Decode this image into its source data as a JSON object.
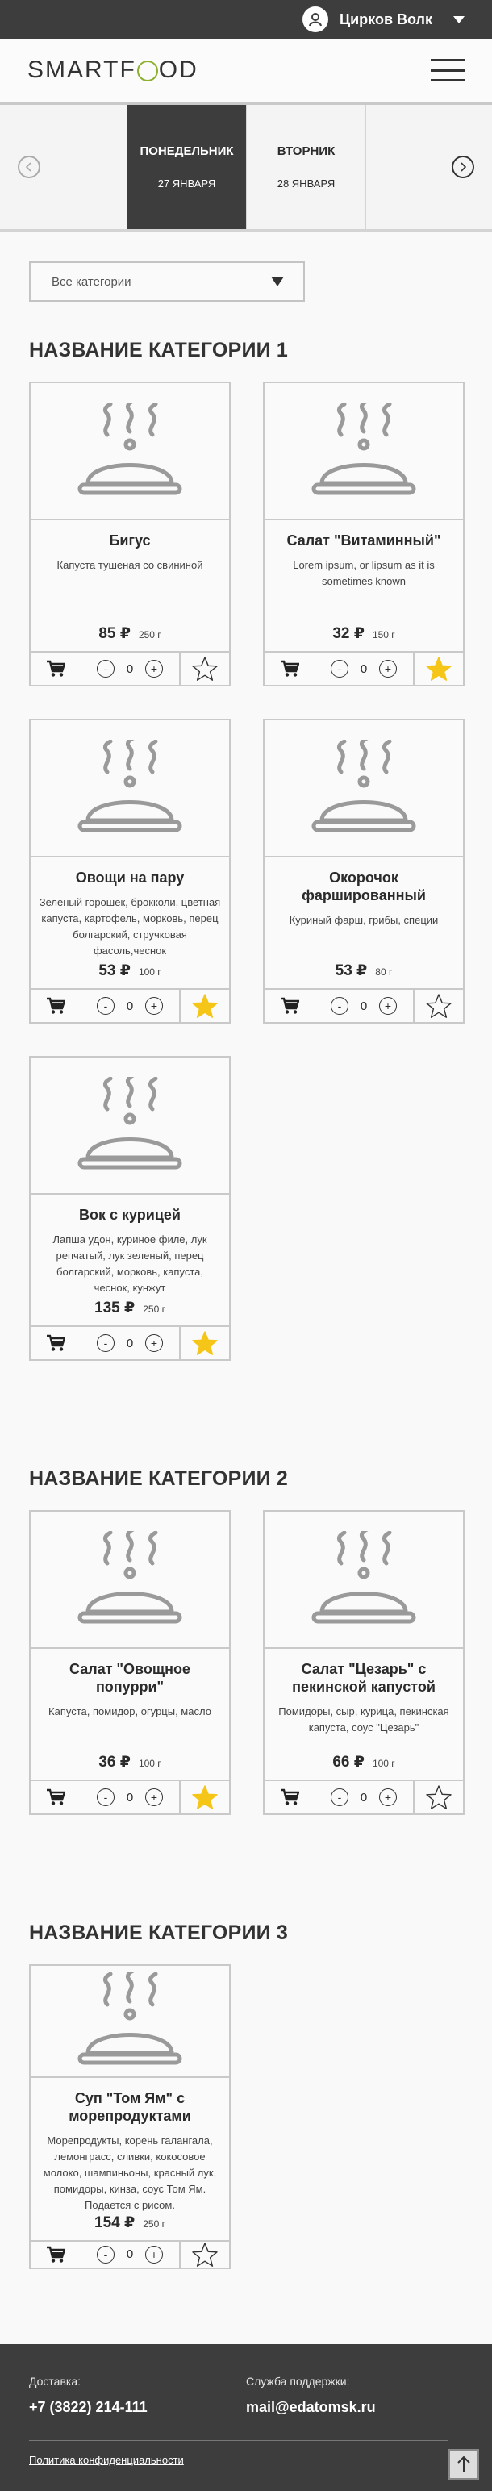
{
  "user": {
    "name": "Цирков Волк"
  },
  "logo": {
    "left": "SMARTF",
    "right": "OD"
  },
  "days": [
    {
      "name": "ПОНЕДЕЛЬНИК",
      "date": "27 ЯНВАРЯ",
      "active": true
    },
    {
      "name": "ВТОРНИК",
      "date": "28 ЯНВАРЯ",
      "active": false
    }
  ],
  "filter": {
    "value": "Все категории"
  },
  "categories": [
    {
      "title": "НАЗВАНИЕ КАТЕГОРИИ 1",
      "items": [
        {
          "title": "Бигус",
          "desc": "Капуста тушеная со свининой",
          "price": "85 ₽",
          "weight": "250 г",
          "qty": "0",
          "fav": false
        },
        {
          "title": "Салат \"Витаминный\"",
          "desc": "Lorem ipsum, or lipsum as it is sometimes known",
          "price": "32 ₽",
          "weight": "150 г",
          "qty": "0",
          "fav": true
        },
        {
          "title": "Овощи на пару",
          "desc": "Зеленый горошек, брокколи, цветная капуста, картофель, морковь, перец болгарский, стручковая фасоль,чеснок",
          "price": "53 ₽",
          "weight": "100 г",
          "qty": "0",
          "fav": true
        },
        {
          "title": "Окорочок фаршированный",
          "desc": "Куриный фарш, грибы, специи",
          "price": "53 ₽",
          "weight": "80 г",
          "qty": "0",
          "fav": false
        },
        {
          "title": "Вок с курицей",
          "desc": "Лапша удон, куриное филе, лук репчатый, лук зеленый, перец болгарский, морковь, капуста, чеснок, кунжут",
          "price": "135 ₽",
          "weight": "250 г",
          "qty": "0",
          "fav": true
        }
      ]
    },
    {
      "title": "НАЗВАНИЕ КАТЕГОРИИ 2",
      "items": [
        {
          "title": "Салат \"Овощное попурри\"",
          "desc": "Капуста, помидор, огурцы, масло",
          "price": "36 ₽",
          "weight": "100 г",
          "qty": "0",
          "fav": true
        },
        {
          "title": "Салат \"Цезарь\" с пекинской капустой",
          "desc": "Помидоры, сыр, курица, пекинская капуста, соус \"Цезарь\"",
          "price": "66 ₽",
          "weight": "100 г",
          "qty": "0",
          "fav": false
        }
      ]
    },
    {
      "title": "НАЗВАНИЕ КАТЕГОРИИ 3",
      "items": [
        {
          "title": "Суп \"Том Ям\" с морепродуктами",
          "desc": "Морепродукты, корень галангала, лемонграсс, сливки, кокосовое молоко, шампиньоны, красный лук, помидоры, кинза, соус Том Ям. Подается с рисом.",
          "price": "154 ₽",
          "weight": "250 г",
          "qty": "0",
          "fav": false
        }
      ]
    }
  ],
  "footer": {
    "delivery_label": "Доставка:",
    "delivery_phone": "+7 (3822) 214-111",
    "support_label": "Служба поддержки:",
    "support_email": "mail@edatomsk.ru",
    "policy_link": "Политика конфиденциальности"
  },
  "colors": {
    "dark": "#3d3d3d",
    "star_active": "#f5c518",
    "logo_accent": "#8db02f"
  },
  "icons": [
    "user-icon",
    "chevron-down-icon",
    "burger-menu-icon",
    "arrow-left-icon",
    "arrow-right-icon",
    "dish-cloche-icon",
    "cart-icon",
    "minus-icon",
    "plus-icon",
    "star-icon",
    "arrow-up-icon"
  ]
}
